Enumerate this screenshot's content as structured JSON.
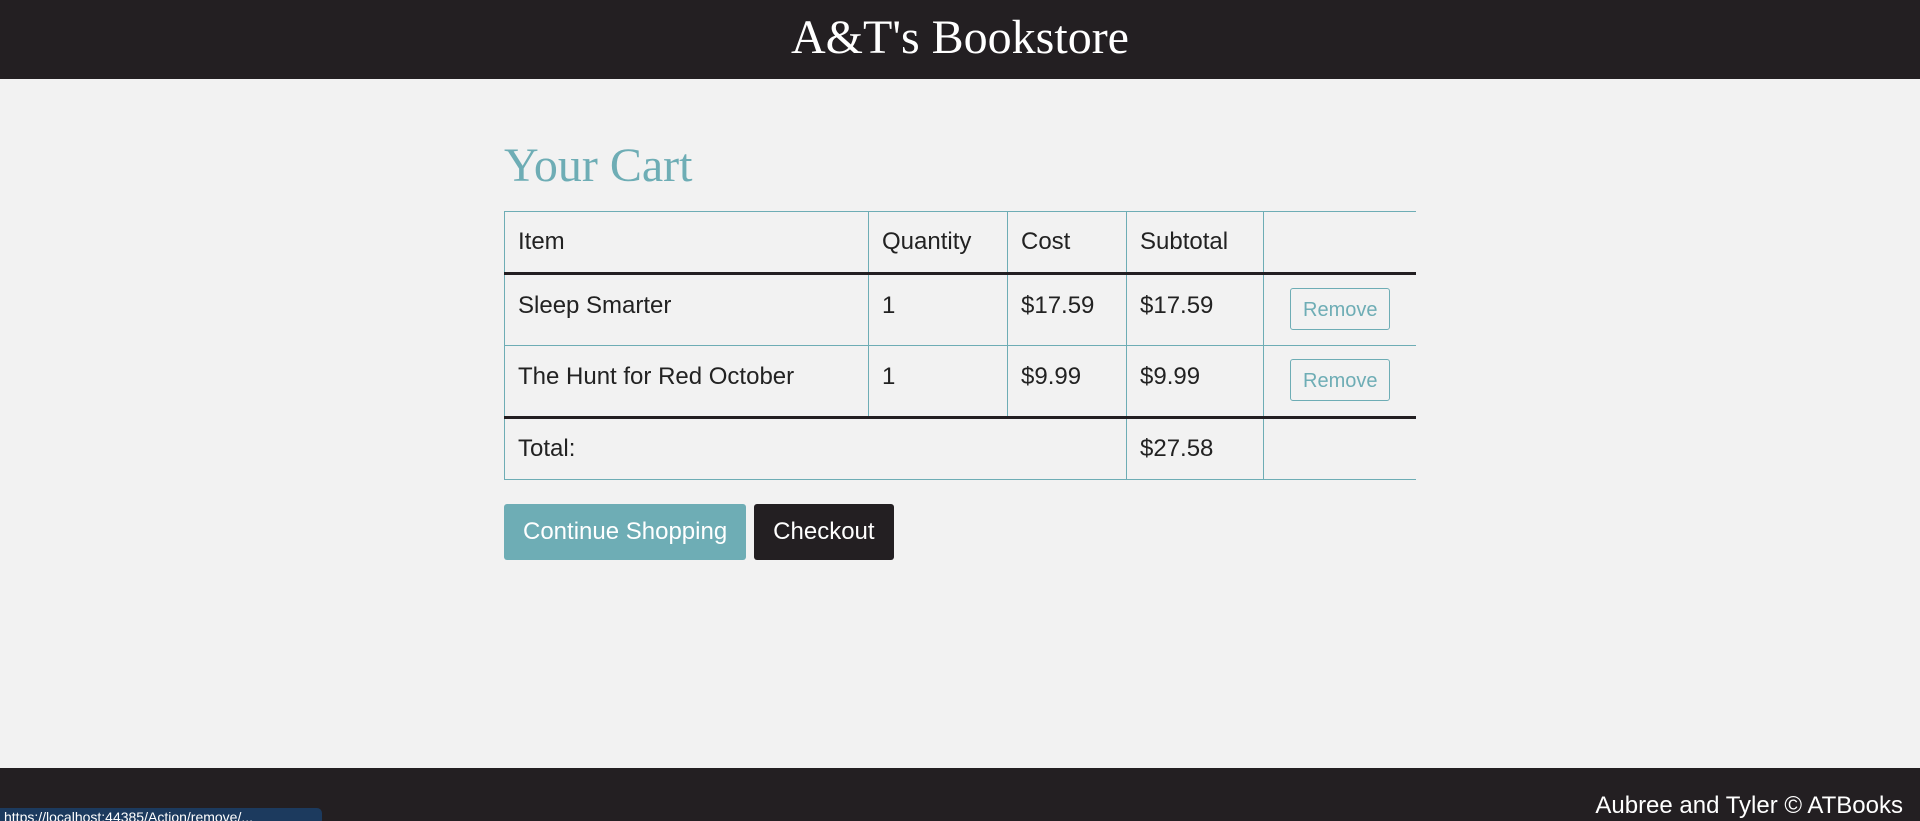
{
  "header": {
    "brand": "A&T's Bookstore"
  },
  "cart": {
    "title": "Your Cart",
    "columns": [
      "Item",
      "Quantity",
      "Cost",
      "Subtotal",
      ""
    ],
    "items": [
      {
        "name": "Sleep Smarter",
        "quantity": "1",
        "cost": "$17.59",
        "subtotal": "$17.59",
        "remove_label": "Remove"
      },
      {
        "name": "The Hunt for Red October",
        "quantity": "1",
        "cost": "$9.99",
        "subtotal": "$9.99",
        "remove_label": "Remove"
      }
    ],
    "total_label": "Total:",
    "total_value": "$27.58"
  },
  "actions": {
    "continue_label": "Continue Shopping",
    "checkout_label": "Checkout"
  },
  "footer": {
    "copyright": "Aubree and Tyler © ATBooks"
  },
  "status_bar": {
    "url": "https://localhost:44385/Action/remove/..."
  },
  "colors": {
    "dark": "#231f22",
    "accent": "#6eadb5",
    "background": "#f2f2f2"
  }
}
